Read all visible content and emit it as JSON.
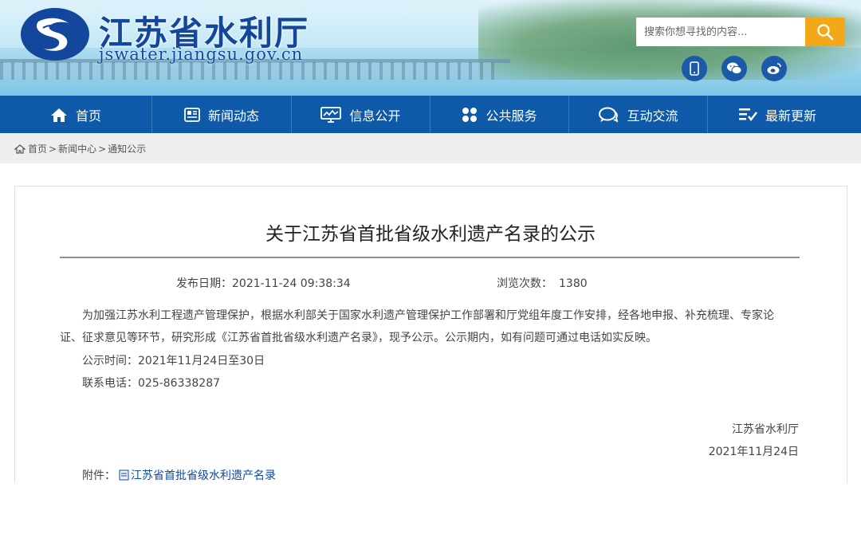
{
  "header": {
    "site_title": "江苏省水利厅",
    "site_domain": "jswater.jiangsu.gov.cn",
    "search": {
      "placeholder": "搜索你想寻找的内容..."
    },
    "social": [
      "mobile-icon",
      "wechat-icon",
      "weibo-icon"
    ]
  },
  "nav": {
    "items": [
      {
        "label": "首页",
        "icon": "home-icon"
      },
      {
        "label": "新闻动态",
        "icon": "news-icon"
      },
      {
        "label": "信息公开",
        "icon": "monitor-icon"
      },
      {
        "label": "公共服务",
        "icon": "grid-icon"
      },
      {
        "label": "互动交流",
        "icon": "chat-icon"
      },
      {
        "label": "最新更新",
        "icon": "list-check-icon"
      }
    ]
  },
  "breadcrumb": {
    "items": [
      "首页",
      "新闻中心",
      "通知公示"
    ],
    "separator": ">"
  },
  "article": {
    "title": "关于江苏省首批省级水利遗产名录的公示",
    "publish_date_label": "发布日期：",
    "publish_date": "2021-11-24 09:38:34",
    "views_label": "浏览次数：",
    "views": "1380",
    "paragraph_line1": "为加强江苏水利工程遗产管理保护，根据水利部关于国家水利遗产管理保护工作部署和厅党组年度工作安排，经各地申报、补充梳理、专家论",
    "paragraph_line2": "证、征求意见等环节，研究形成《江苏省首批省级水利遗产名录》，现予公示。公示期内，如有问题可通过电话如实反映。",
    "notice_time": "公示时间：2021年11月24日至30日",
    "contact": "联系电话：025-86338287",
    "signature_org": "江苏省水利厅",
    "signature_date": "2021年11月24日",
    "attachment_label": "附件：",
    "attachment_name": "江苏省首批省级水利遗产名录"
  },
  "colors": {
    "brand_blue": "#13479b",
    "nav_blue": "#0e5aa8",
    "search_button": "#f3a81a"
  }
}
